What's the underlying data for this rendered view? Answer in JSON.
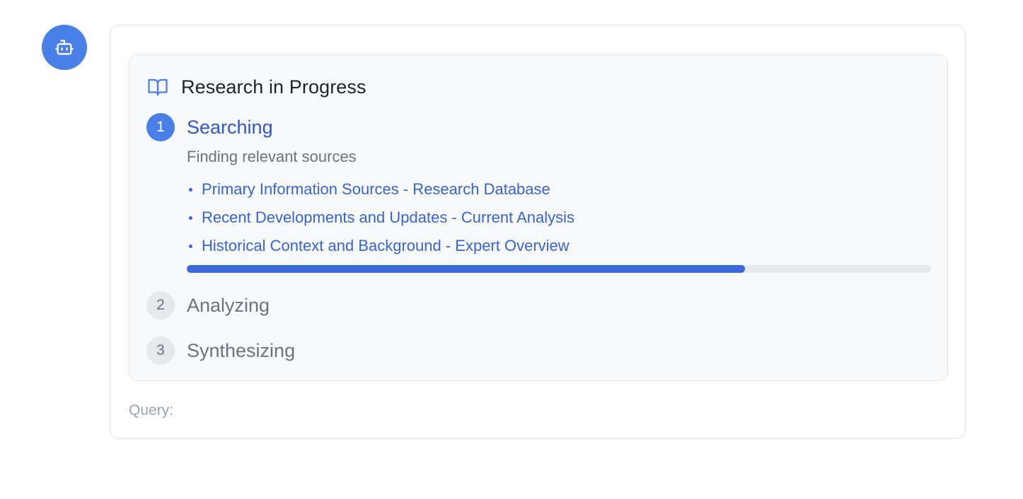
{
  "assistant": {
    "avatar_icon": "robot-icon",
    "accent_color": "#4a7fe8"
  },
  "research": {
    "title": "Research in Progress",
    "title_icon": "book-open-icon",
    "steps": [
      {
        "number": "1",
        "label": "Searching",
        "status": "active",
        "description": "Finding relevant sources",
        "sources": [
          "Primary Information Sources - Research Database",
          "Recent Developments and Updates - Current Analysis",
          "Historical Context and Background - Expert Overview"
        ],
        "progress": 0.75
      },
      {
        "number": "2",
        "label": "Analyzing",
        "status": "pending"
      },
      {
        "number": "3",
        "label": "Synthesizing",
        "status": "pending"
      }
    ]
  },
  "query": {
    "label": "Query:",
    "value": ""
  }
}
